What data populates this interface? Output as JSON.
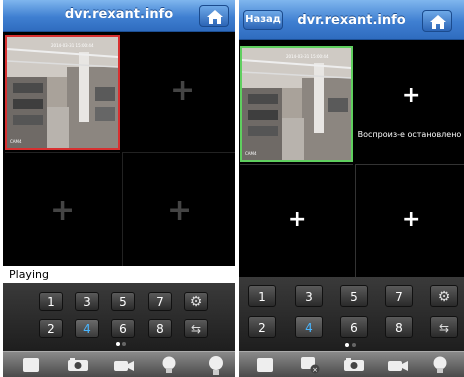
{
  "left": {
    "title": "dvr.rexant.info",
    "status": "Playing",
    "camera_timestamp": "2014-03-31 15:00:44",
    "camera_label": "CAM4",
    "keypad": [
      "1",
      "3",
      "5",
      "7",
      "2",
      "4",
      "6",
      "8"
    ],
    "selected": "4"
  },
  "right": {
    "back_label": "Назад",
    "title": "dvr.rexant.info",
    "stopped_text": "Воспроиз-е остановлено",
    "camera_timestamp": "2014-03-31 15:00:44",
    "camera_label": "CAM4",
    "keypad": [
      "1",
      "3",
      "5",
      "7",
      "2",
      "4",
      "6",
      "8"
    ],
    "selected": "4"
  },
  "icons": {
    "home": "home-icon",
    "settings": "gear-icon",
    "swap": "swap-icon",
    "stop": "stop-icon",
    "snapshot": "camera-icon",
    "record": "video-icon",
    "talk": "bulb-icon",
    "mic": "microphone-icon",
    "close_view": "close-view-icon"
  },
  "colors": {
    "title_bar": "#3f7fd1",
    "selected_number": "#49b6ff",
    "active_left_border": "#d83030",
    "active_right_border": "#5fcf5f"
  }
}
